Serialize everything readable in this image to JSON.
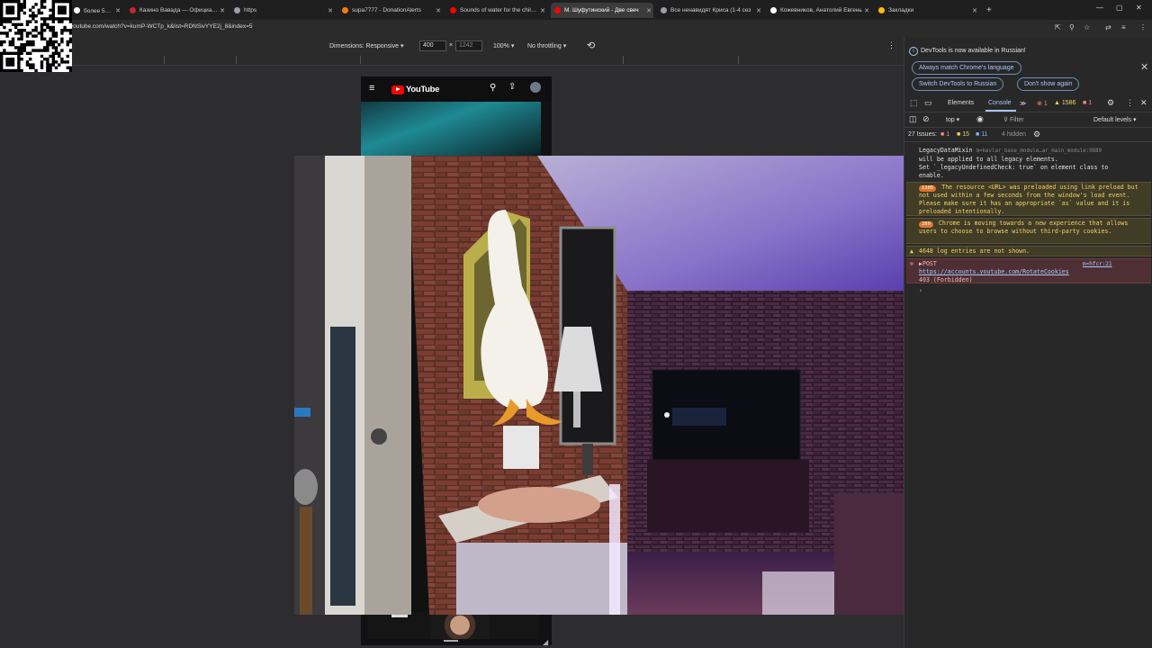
{
  "browser": {
    "tabs": [
      {
        "label": "более 5000 ₽",
        "color": "#ffffff"
      },
      {
        "label": "Казино Вавада — Официальн",
        "color": "#c1272d"
      },
      {
        "label": "https",
        "color": "#9aa0a6"
      },
      {
        "label": "supa7777 - DonationAlerts",
        "color": "#f57d07"
      },
      {
        "label": "Sounds of water for the child tr",
        "color": "#ff0000"
      },
      {
        "label": "М. Шуфутинский - Две свеч",
        "color": "#ff0000"
      },
      {
        "label": "Все ненавидят Криса (1-4 сез",
        "color": "#9aa0a6"
      },
      {
        "label": "Кожевников, Анатолий Евгень",
        "color": "#ffffff"
      },
      {
        "label": "Закладки",
        "color": "#fbbc04"
      }
    ],
    "new_tab": "+",
    "url": "youtube.com/watch?v=kumP-WCTp_k&list=RDNSivYYE2j_8&index=5"
  },
  "device_toolbar": {
    "dimensions_label": "Dimensions: Responsive",
    "width": "400",
    "times": "×",
    "height": "1242",
    "zoom": "100%",
    "throttle": "No throttling"
  },
  "youtube": {
    "logo_text": "YouTube"
  },
  "devtools": {
    "info_text": "DevTools is now available in Russian!",
    "btn_match": "Always match Chrome's language",
    "btn_switch": "Switch DevTools to Russian",
    "btn_dont": "Don't show again",
    "tab_elements": "Elements",
    "tab_console": "Console",
    "more_tabs": "≫",
    "err_count": "1",
    "warn_count": "1586",
    "issue_count": "1",
    "context": "top",
    "filter_placeholder": "Filter",
    "levels": "Default levels",
    "issues_label": "27 Issues:",
    "issues_err": "1",
    "issues_warn": "15",
    "issues_info": "11",
    "hidden": "4 hidden",
    "msg1_name": "LegacyDataMixin",
    "msg1_src": "m=kevlar_base_module…ar_main_module:9889",
    "msg1_line2": "will be applied to all legacy elements.",
    "msg1_line3": "Set `_legacyUndefinedCheck: true` on element class to",
    "msg1_line4": "enable.",
    "msg2_badge": "1305",
    "msg2_text": "The resource <URL> was preloaded using link preload but not used within a few seconds from the window's load event. Please make sure it has an appropriate `as` value and it is preloaded intentionally.",
    "msg3_badge": "280",
    "msg3_text": "Chrome is moving towards a new experience that allows users to choose to browse without third-party cookies.",
    "msg4_text": "4648 log entries are not shown.",
    "msg5_method": "▶POST",
    "msg5_src": "m=hfcr:21",
    "msg5_url": "https://accounts.youtube.com/RotateCookies",
    "msg5_status": "403 (Forbidden)",
    "prompt": "›"
  }
}
